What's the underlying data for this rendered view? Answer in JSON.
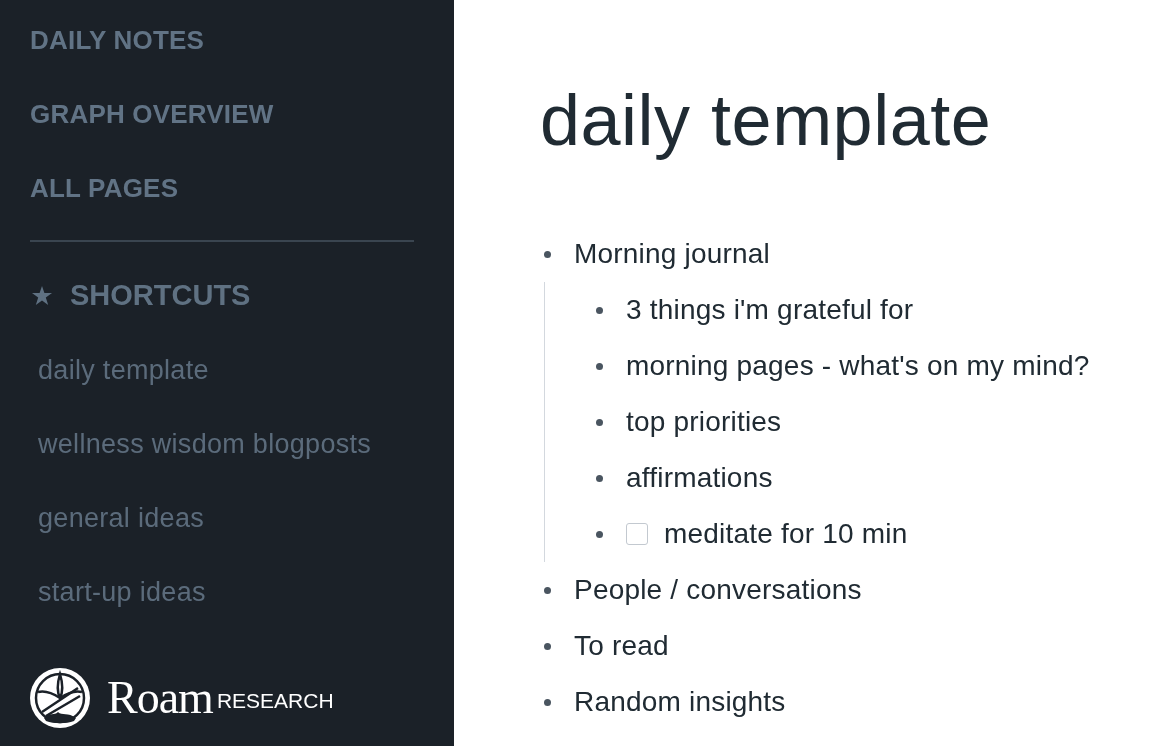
{
  "sidebar": {
    "nav_items": [
      {
        "label": "DAILY NOTES"
      },
      {
        "label": "GRAPH OVERVIEW"
      },
      {
        "label": "ALL PAGES"
      }
    ],
    "shortcuts": {
      "title": "SHORTCUTS",
      "items": [
        {
          "label": "daily template"
        },
        {
          "label": "wellness wisdom blogposts"
        },
        {
          "label": "general ideas"
        },
        {
          "label": "start-up ideas"
        }
      ]
    },
    "logo": {
      "name": "Roam",
      "subtitle": "RESEARCH"
    }
  },
  "page": {
    "title": "daily template",
    "blocks": [
      {
        "kind": "text",
        "text": "Morning journal",
        "children": [
          {
            "kind": "text",
            "text": "3 things i'm grateful for"
          },
          {
            "kind": "text",
            "text": "morning pages - what's on my mind?"
          },
          {
            "kind": "text",
            "text": "top priorities"
          },
          {
            "kind": "text",
            "text": "affirmations"
          },
          {
            "kind": "todo",
            "checked": false,
            "text": "meditate for 10 min"
          }
        ]
      },
      {
        "kind": "text",
        "text": "People / conversations"
      },
      {
        "kind": "text",
        "text": "To read"
      },
      {
        "kind": "text",
        "text": "Random insights"
      }
    ]
  }
}
